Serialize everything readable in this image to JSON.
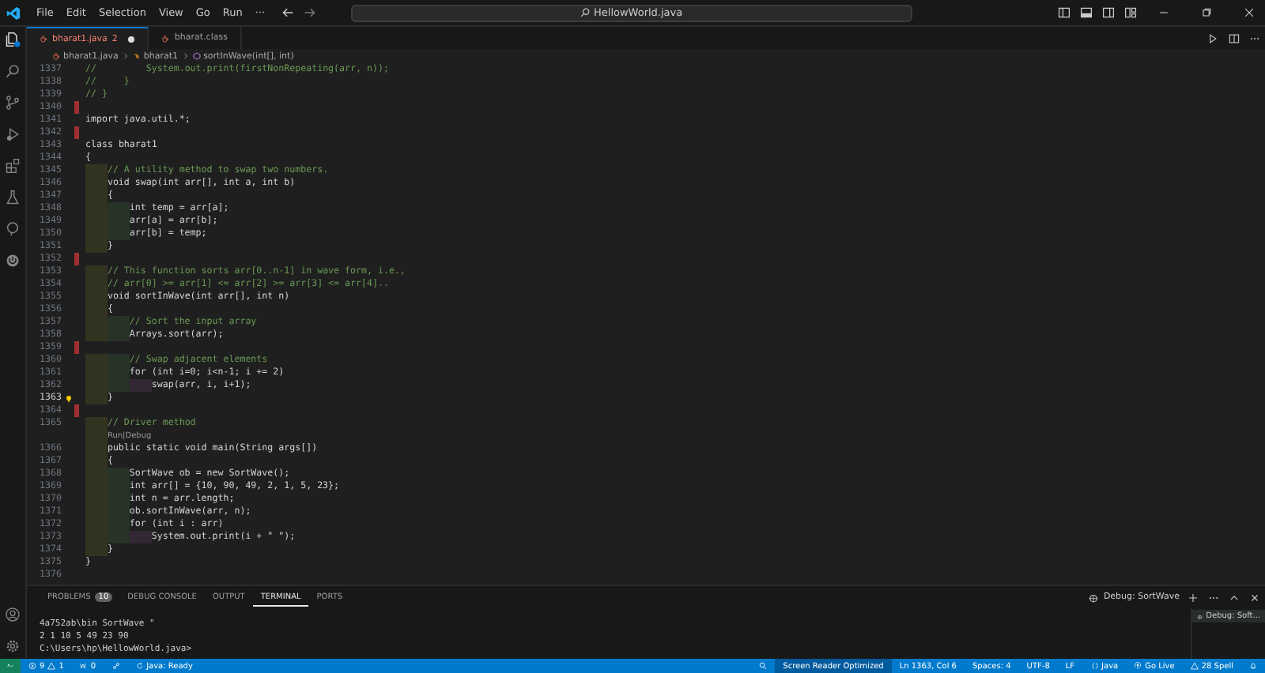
{
  "menu": [
    "File",
    "Edit",
    "Selection",
    "View",
    "Go",
    "Run",
    "···"
  ],
  "command_center": "HellowWorld.java",
  "tabs": [
    {
      "label": "bharat1.java",
      "problems": "2",
      "modified": true,
      "selected": true
    },
    {
      "label": "bharat.class",
      "modified": false,
      "selected": false
    }
  ],
  "breadcrumb": [
    "bharat1.java",
    "bharat1",
    "sortInWave(int[], int)"
  ],
  "lines": [
    {
      "number": "1337",
      "kind": "comment",
      "text": "//         System.out.print(firstNonRepeating(arr, n));",
      "marker": false,
      "current": false
    },
    {
      "number": "1338",
      "kind": "comment",
      "text": "//     }",
      "marker": false,
      "current": false
    },
    {
      "number": "1339",
      "kind": "comment",
      "text": "// }",
      "marker": false,
      "current": false
    },
    {
      "number": "1340",
      "marker": true,
      "current": false
    },
    {
      "number": "1341",
      "kind": "code",
      "text": "import java.util.*;",
      "marker": false,
      "current": false
    },
    {
      "number": "1342",
      "marker": true,
      "current": false
    },
    {
      "number": "1343",
      "kind": "code",
      "text": "class bharat1",
      "marker": false,
      "current": false
    },
    {
      "number": "1344",
      "kind": "code",
      "text": "{",
      "marker": false,
      "current": false
    },
    {
      "number": "1345",
      "kind": "comment",
      "text": "    // A utility method to swap two numbers.",
      "marker": false,
      "current": false
    },
    {
      "number": "1346",
      "kind": "code",
      "text": "    void swap(int arr[], int a, int b)",
      "marker": false,
      "current": false
    },
    {
      "number": "1347",
      "kind": "code",
      "text": "    {",
      "marker": false,
      "current": false
    },
    {
      "number": "1348",
      "kind": "code",
      "text": "        int temp = arr[a];",
      "marker": false,
      "current": false
    },
    {
      "number": "1349",
      "kind": "code",
      "text": "        arr[a] = arr[b];",
      "marker": false,
      "current": false
    },
    {
      "number": "1350",
      "kind": "code",
      "text": "        arr[b] = temp;",
      "marker": false,
      "current": false
    },
    {
      "number": "1351",
      "kind": "code",
      "text": "    }",
      "marker": false,
      "current": false
    },
    {
      "number": "1352",
      "marker": true,
      "current": false
    },
    {
      "number": "1353",
      "kind": "comment",
      "text": "    // This function sorts arr[0..n-1] in wave form, i.e.,",
      "marker": false,
      "current": false
    },
    {
      "number": "1354",
      "kind": "comment",
      "text": "    // arr[0] >= arr[1] <= arr[2] >= arr[3] <= arr[4]..",
      "marker": false,
      "current": false
    },
    {
      "number": "1355",
      "kind": "code",
      "text": "    void sortInWave(int arr[], int n)",
      "marker": false,
      "current": false
    },
    {
      "number": "1356",
      "kind": "code",
      "text": "    {",
      "marker": false,
      "current": false
    },
    {
      "number": "1357",
      "kind": "comment",
      "text": "        // Sort the input array",
      "marker": false,
      "current": false
    },
    {
      "number": "1358",
      "kind": "code",
      "text": "        Arrays.sort(arr);",
      "marker": false,
      "current": false
    },
    {
      "number": "1359",
      "marker": true,
      "current": false
    },
    {
      "number": "1360",
      "kind": "comment",
      "text": "        // Swap adjacent elements",
      "marker": false,
      "current": false
    },
    {
      "number": "1361",
      "kind": "code",
      "text": "        for (int i=0; i<n-1; i += 2)",
      "marker": false,
      "current": false
    },
    {
      "number": "1362",
      "kind": "code",
      "text": "            swap(arr, i, i+1);",
      "marker": false,
      "current": false
    },
    {
      "number": "1363",
      "kind": "code",
      "text": "    }",
      "marker": false,
      "current": true
    },
    {
      "number": "1364",
      "marker": true,
      "current": false
    },
    {
      "number": "1365",
      "kind": "comment",
      "text": "    // Driver method",
      "marker": false,
      "current": false
    },
    {
      "kind": "codelens",
      "text": "    Run|Debug"
    },
    {
      "number": "1366",
      "kind": "code",
      "text": "    public static void main(String args[])",
      "marker": false,
      "current": false
    },
    {
      "number": "1367",
      "kind": "code",
      "text": "    {",
      "marker": false,
      "current": false
    },
    {
      "number": "1368",
      "kind": "code",
      "text": "        SortWave ob = new SortWave();",
      "marker": false,
      "current": false
    },
    {
      "number": "1369",
      "kind": "code",
      "text": "        int arr[] = {10, 90, 49, 2, 1, 5, 23};",
      "marker": false,
      "current": false
    },
    {
      "number": "1370",
      "kind": "code",
      "text": "        int n = arr.length;",
      "marker": false,
      "current": false
    },
    {
      "number": "1371",
      "kind": "code",
      "text": "        ob.sortInWave(arr, n);",
      "marker": false,
      "current": false
    },
    {
      "number": "1372",
      "kind": "code",
      "text": "        for (int i : arr)",
      "marker": false,
      "current": false
    },
    {
      "number": "1373",
      "kind": "code",
      "text": "            System.out.print(i + \" \");",
      "marker": false,
      "current": false
    },
    {
      "number": "1374",
      "kind": "code",
      "text": "    }",
      "marker": false,
      "current": false
    },
    {
      "number": "1375",
      "kind": "code",
      "text": "}",
      "marker": false,
      "current": false
    },
    {
      "number": "1376",
      "marker": false,
      "current": false
    }
  ],
  "panel": {
    "tabs": [
      {
        "label": "PROBLEMS",
        "badge": "10",
        "selected": false
      },
      {
        "label": "DEBUG CONSOLE",
        "selected": false
      },
      {
        "label": "OUTPUT",
        "selected": false
      },
      {
        "label": "TERMINAL",
        "selected": true
      },
      {
        "label": "PORTS",
        "selected": false
      }
    ],
    "terminal_name": "Debug: SortWave",
    "terminal_lines": [
      "4a752ab\\bin SortWave \"",
      "2 1 10 5 49 23 90",
      "C:\\Users\\hp\\HellowWorld.java>"
    ],
    "terminal_list": [
      "Debug: Soft..."
    ]
  },
  "status": {
    "errors": "9",
    "warnings": "1",
    "ports": "0",
    "java": "Java: Ready",
    "right": [
      {
        "kind": "zoom"
      },
      {
        "text": "Screen Reader Optimized",
        "kind": "mode"
      },
      {
        "text": "Ln 1363, Col 6",
        "kind": "plain"
      },
      {
        "text": "Spaces: 4",
        "kind": "plain"
      },
      {
        "text": "UTF-8",
        "kind": "plain"
      },
      {
        "text": "LF",
        "kind": "plain"
      },
      {
        "text": "Java",
        "kind": "language"
      },
      {
        "text": "Go Live",
        "kind": "live"
      },
      {
        "text": "28 Spell",
        "kind": "spell"
      },
      {
        "kind": "notifications"
      }
    ]
  }
}
